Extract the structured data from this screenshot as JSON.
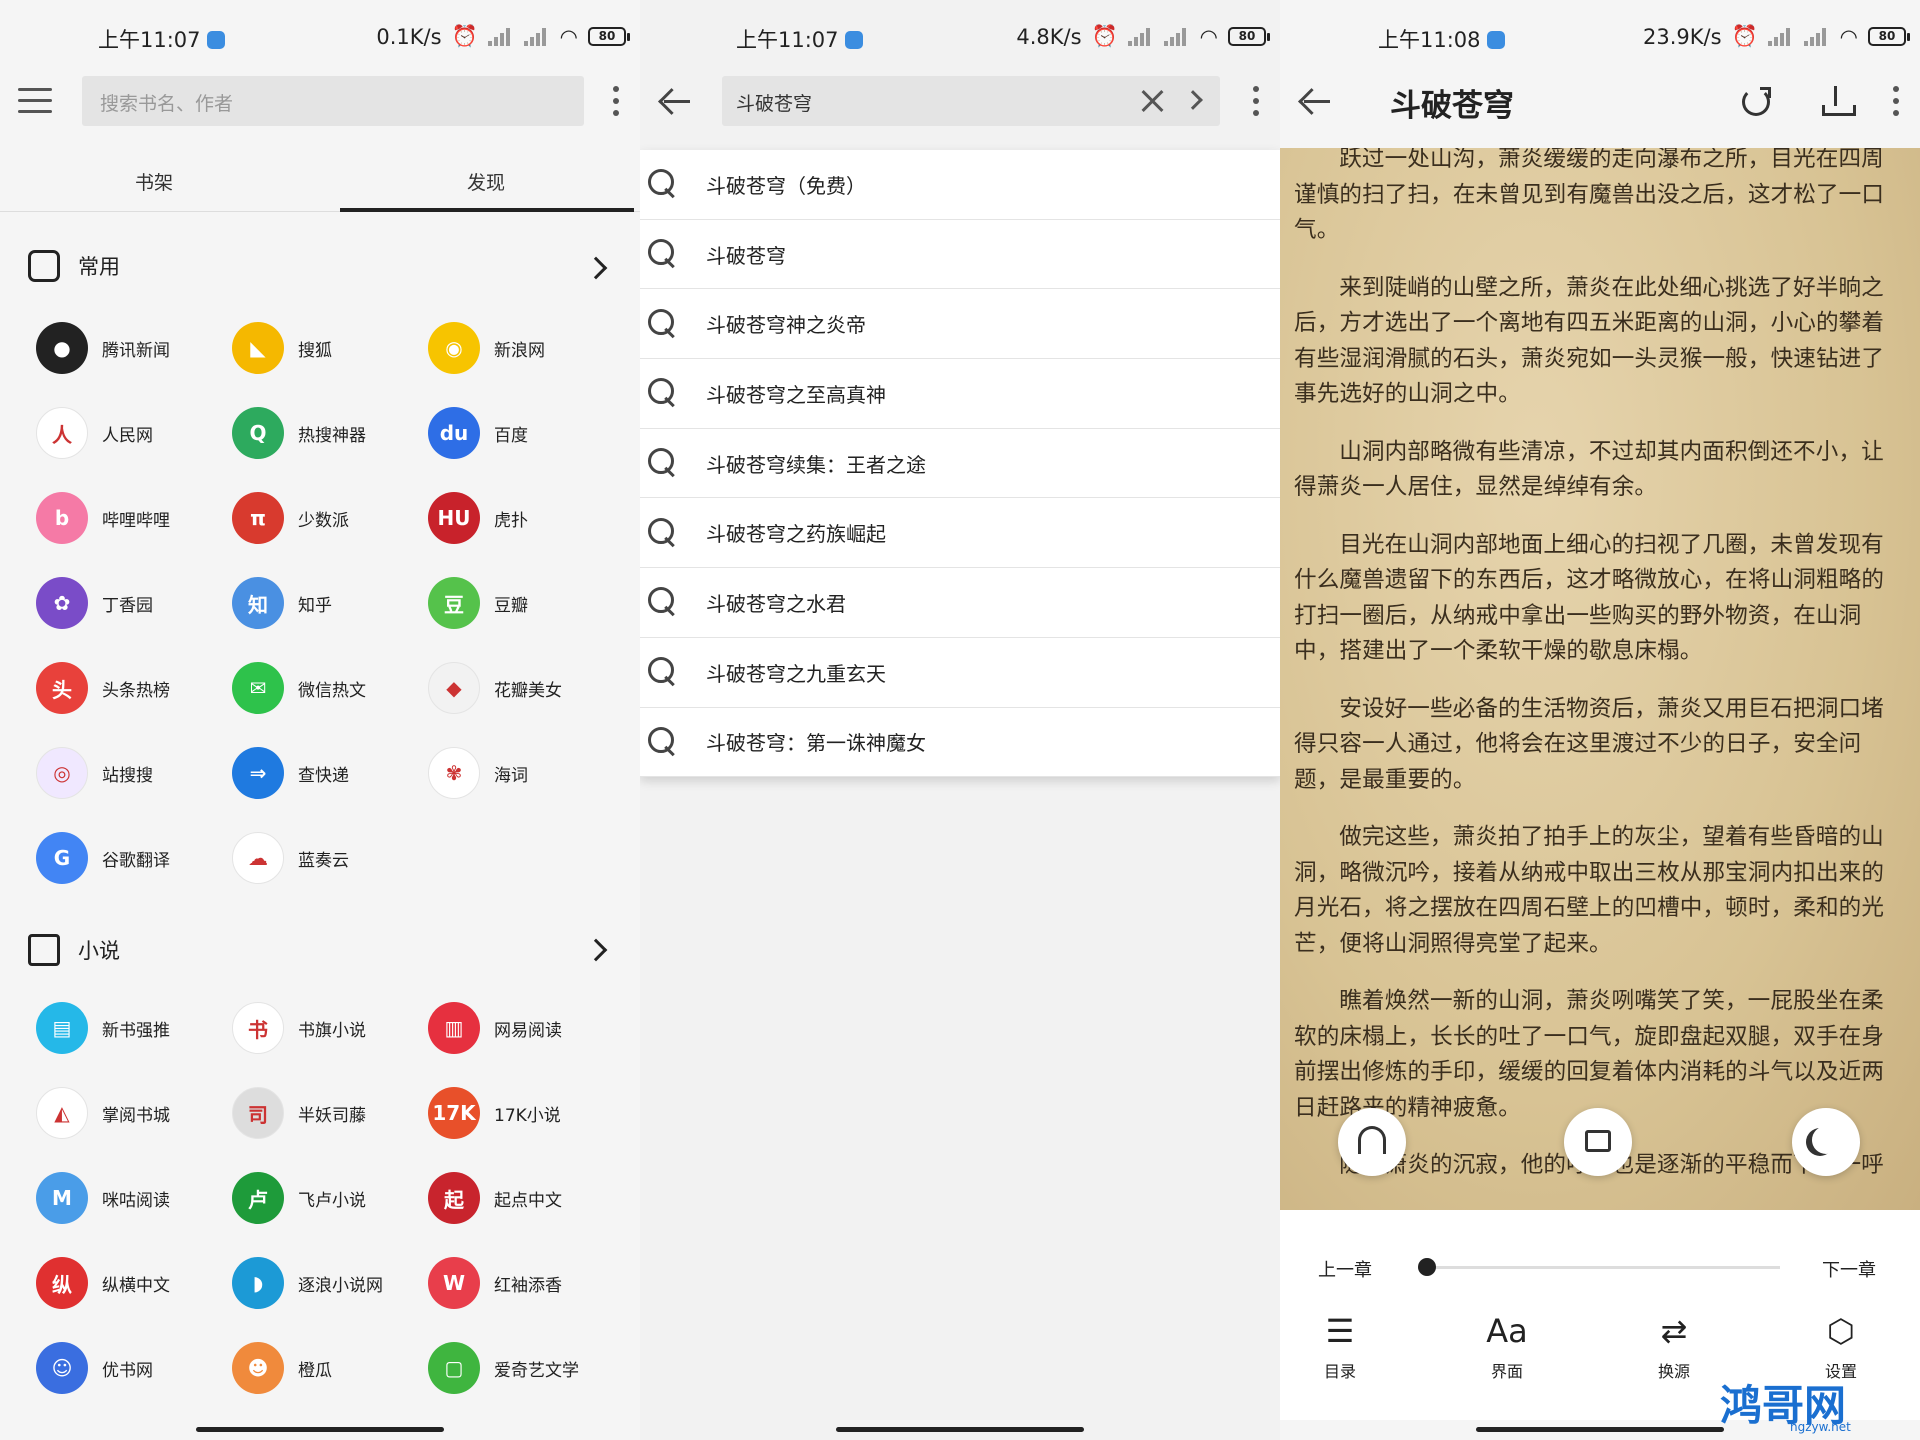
{
  "status": [
    {
      "time": "上午11:07",
      "speed": "0.1K/s",
      "battery": "80"
    },
    {
      "time": "上午11:07",
      "speed": "4.8K/s",
      "battery": "80"
    },
    {
      "time": "上午11:08",
      "speed": "23.9K/s",
      "battery": "80"
    }
  ],
  "bookshelf": {
    "search_placeholder": "搜索书名、作者",
    "tabs": [
      "书架",
      "发现"
    ],
    "sections": [
      {
        "title": "常用",
        "items": [
          {
            "label": "腾讯新闻",
            "color": "#222222",
            "glyph": "●"
          },
          {
            "label": "搜狐",
            "color": "#f5b800",
            "glyph": "◣"
          },
          {
            "label": "新浪网",
            "color": "#f7c400",
            "glyph": "◉"
          },
          {
            "label": "人民网",
            "color": "#ffffff",
            "glyph": "人"
          },
          {
            "label": "热搜神器",
            "color": "#2daa5e",
            "glyph": "Q"
          },
          {
            "label": "百度",
            "color": "#2e6ee6",
            "glyph": "du"
          },
          {
            "label": "哔哩哔哩",
            "color": "#f57aa6",
            "glyph": "b"
          },
          {
            "label": "少数派",
            "color": "#d83a2e",
            "glyph": "π"
          },
          {
            "label": "虎扑",
            "color": "#c8222b",
            "glyph": "HU"
          },
          {
            "label": "丁香园",
            "color": "#7a4cc8",
            "glyph": "✿"
          },
          {
            "label": "知乎",
            "color": "#4a90e2",
            "glyph": "知"
          },
          {
            "label": "豆瓣",
            "color": "#55c24b",
            "glyph": "豆"
          },
          {
            "label": "头条热榜",
            "color": "#e8413b",
            "glyph": "头"
          },
          {
            "label": "微信热文",
            "color": "#2ec24b",
            "glyph": "✉"
          },
          {
            "label": "花瓣美女",
            "color": "#f2f2f2",
            "glyph": "◆"
          },
          {
            "label": "站搜搜",
            "color": "#f0e8ff",
            "glyph": "◎"
          },
          {
            "label": "查快递",
            "color": "#1f7ae0",
            "glyph": "⇒"
          },
          {
            "label": "海词",
            "color": "#ffffff",
            "glyph": "✾"
          },
          {
            "label": "谷歌翻译",
            "color": "#4285f4",
            "glyph": "G"
          },
          {
            "label": "蓝奏云",
            "color": "#ffffff",
            "glyph": "☁"
          }
        ]
      },
      {
        "title": "小说",
        "items": [
          {
            "label": "新书强推",
            "color": "#25b8e8",
            "glyph": "▤"
          },
          {
            "label": "书旗小说",
            "color": "#ffffff",
            "glyph": "书"
          },
          {
            "label": "网易阅读",
            "color": "#e6303f",
            "glyph": "▥"
          },
          {
            "label": "掌阅书城",
            "color": "#ffffff",
            "glyph": "◭"
          },
          {
            "label": "半妖司藤",
            "color": "#dddddd",
            "glyph": "司"
          },
          {
            "label": "17K小说",
            "color": "#e8502a",
            "glyph": "17K"
          },
          {
            "label": "咪咕阅读",
            "color": "#4a9de8",
            "glyph": "M"
          },
          {
            "label": "飞卢小说",
            "color": "#1e9b3a",
            "glyph": "卢"
          },
          {
            "label": "起点中文",
            "color": "#c8242d",
            "glyph": "起"
          },
          {
            "label": "纵横中文",
            "color": "#e03030",
            "glyph": "纵"
          },
          {
            "label": "逐浪小说网",
            "color": "#1c9ad6",
            "glyph": "◗"
          },
          {
            "label": "红袖添香",
            "color": "#e83e4b",
            "glyph": "W"
          },
          {
            "label": "优书网",
            "color": "#3a6ee0",
            "glyph": "☺"
          },
          {
            "label": "橙瓜",
            "color": "#f08a3c",
            "glyph": "☻"
          },
          {
            "label": "爱奇艺文学",
            "color": "#3fb53f",
            "glyph": "▢"
          }
        ]
      }
    ]
  },
  "search": {
    "query": "斗破苍穹",
    "suggestions": [
      "斗破苍穹（免费）",
      "斗破苍穹",
      "斗破苍穹神之炎帝",
      "斗破苍穹之至高真神",
      "斗破苍穹续集：王者之途",
      "斗破苍穹之药族崛起",
      "斗破苍穹之水君",
      "斗破苍穹之九重玄天",
      "斗破苍穹：第一诛神魔女"
    ]
  },
  "reader": {
    "title": "斗破苍穹",
    "paragraphs": [
      "跃过一处山沟，萧炎缓缓的走向瀑布之所，目光在四周谨慎的扫了扫，在未曾见到有魔兽出没之后，这才松了一口气。",
      "来到陡峭的山壁之所，萧炎在此处细心挑选了好半晌之后，方才选出了一个离地有四五米距离的山洞，小心的攀着有些湿润滑腻的石头，萧炎宛如一头灵猴一般，快速钻进了事先选好的山洞之中。",
      "山洞内部略微有些清凉，不过却其内面积倒还不小，让得萧炎一人居住，显然是绰绰有余。",
      "目光在山洞内部地面上细心的扫视了几圈，未曾发现有什么魔兽遗留下的东西后，这才略微放心，在将山洞粗略的打扫一圈后，从纳戒中拿出一些购买的野外物资，在山洞中，搭建出了一个柔软干燥的歇息床榻。",
      "安设好一些必备的生活物资后，萧炎又用巨石把洞口堵得只容一人通过，他将会在这里渡过不少的日子，安全问题，是最重要的。",
      "做完这些，萧炎拍了拍手上的灰尘，望着有些昏暗的山洞，略微沉吟，接着从纳戒中取出三枚从那宝洞内扣出来的月光石，将之摆放在四周石壁上的凹槽中，顿时，柔和的光芒，便将山洞照得亮堂了起来。",
      "瞧着焕然一新的山洞，萧炎咧嘴笑了笑，一屁股坐在柔软的床榻上，长长的吐了一口气，旋即盘起双腿，双手在身前摆出修炼的手印，缓缓的回复着体内消耗的斗气以及近两日赶路来的精神疲惫。",
      "随着萧炎的沉寂，他的呼吸也是逐渐的平稳而下，一呼"
    ],
    "prev_chapter": "上一章",
    "next_chapter": "下一章",
    "progress": 0,
    "tools": [
      {
        "label": "目录",
        "icon": "list-icon",
        "glyph": "☰"
      },
      {
        "label": "界面",
        "icon": "font-icon",
        "glyph": "Aa"
      },
      {
        "label": "换源",
        "icon": "shuffle-icon",
        "glyph": "⇄"
      },
      {
        "label": "设置",
        "icon": "settings-icon",
        "glyph": "⬡"
      }
    ]
  },
  "watermark": {
    "text": "鸿哥网",
    "sub": "hgzyw.net"
  }
}
